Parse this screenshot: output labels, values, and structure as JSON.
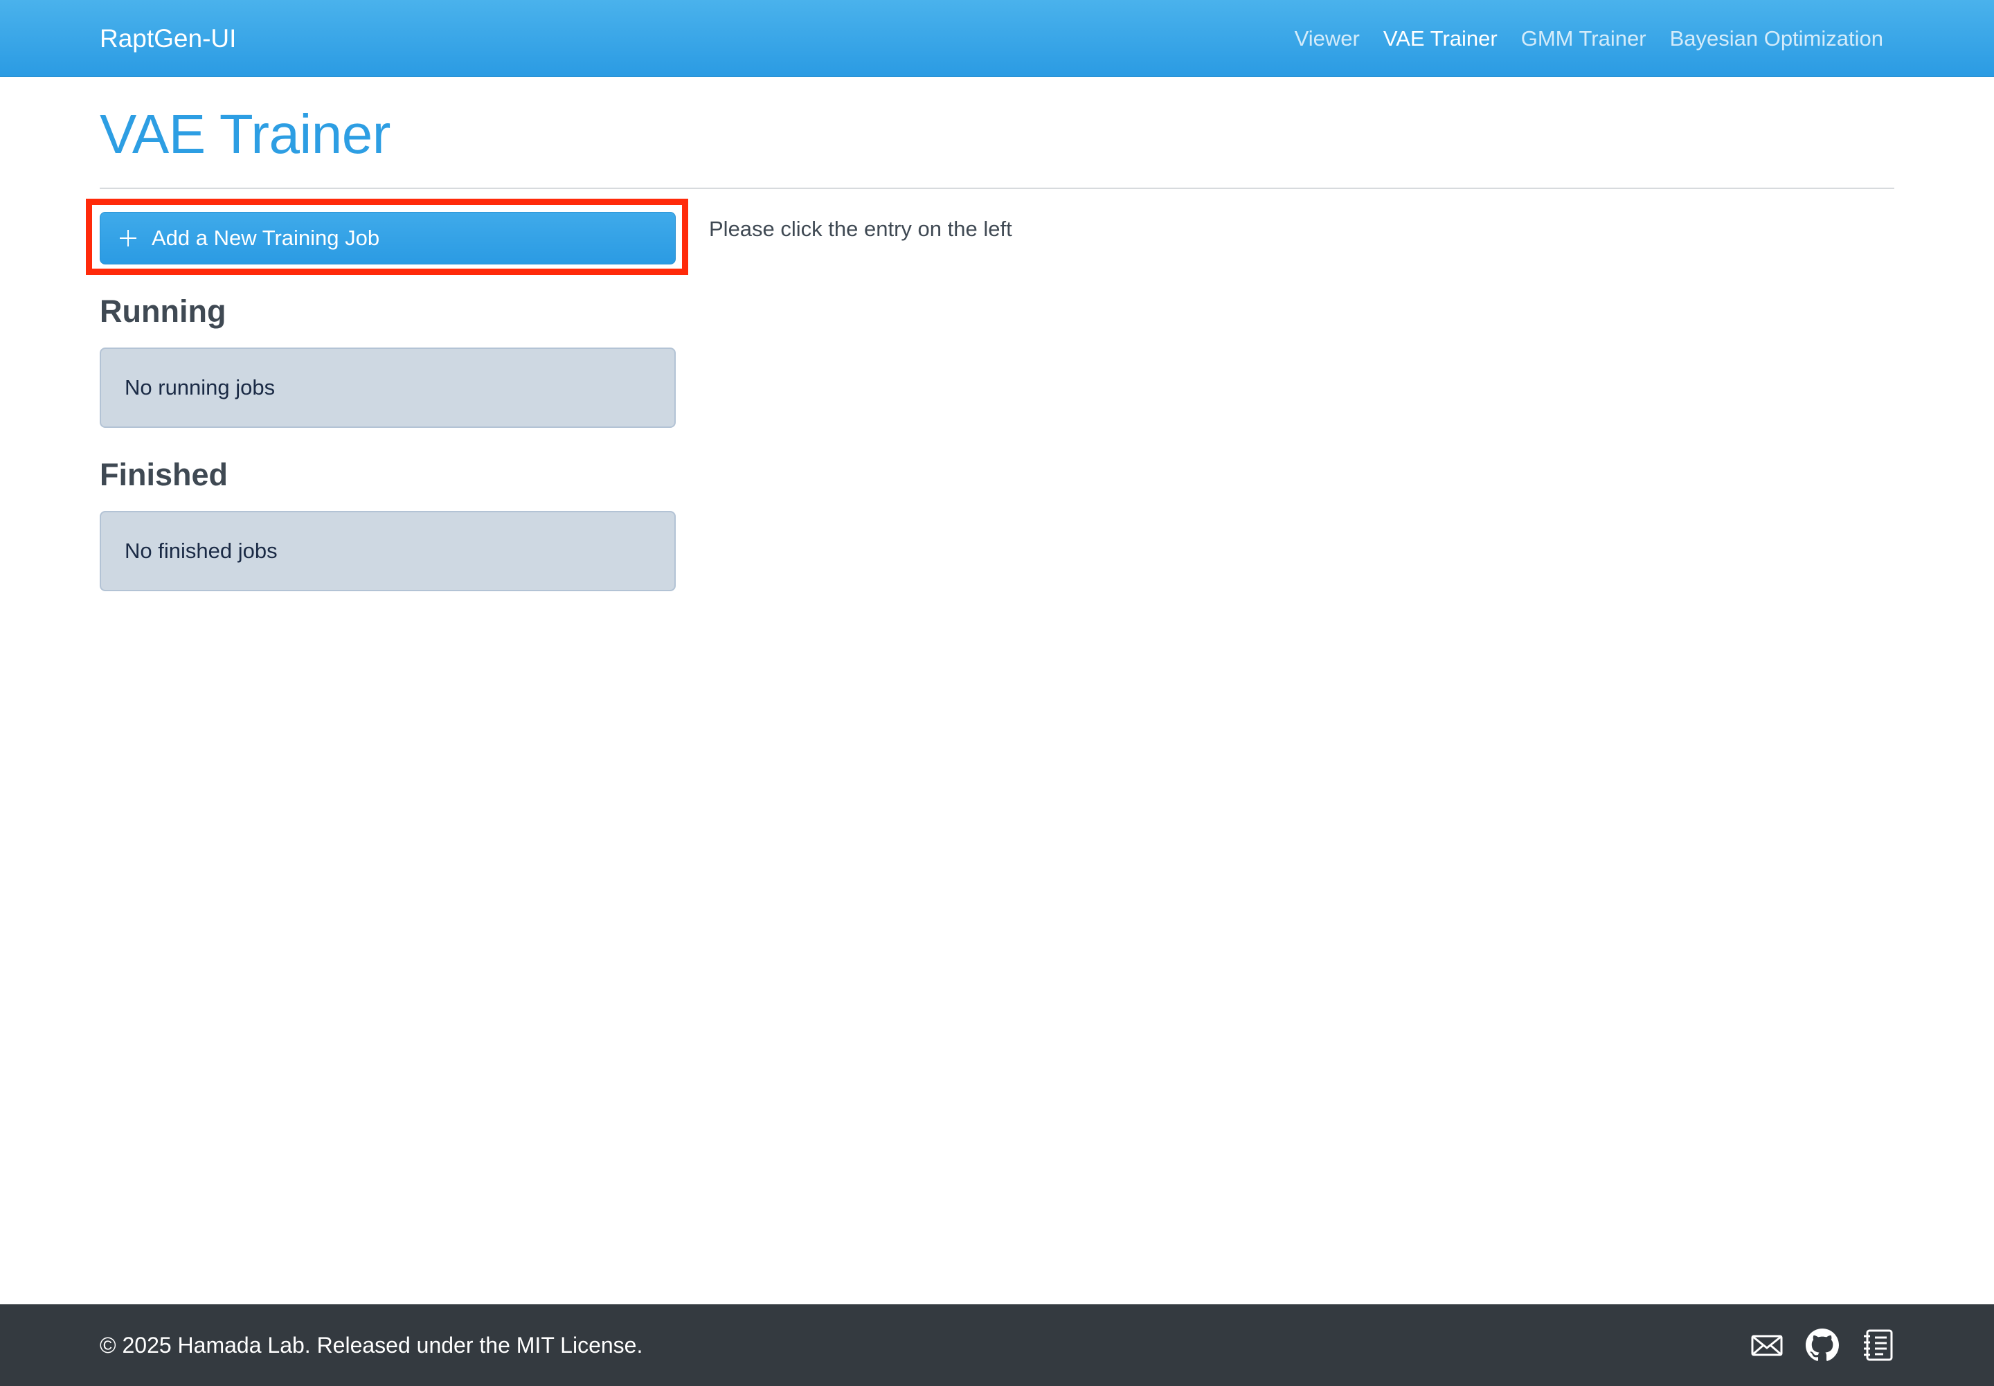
{
  "navbar": {
    "brand": "RaptGen-UI",
    "links": [
      {
        "label": "Viewer",
        "active": false
      },
      {
        "label": "VAE Trainer",
        "active": true
      },
      {
        "label": "GMM Trainer",
        "active": false
      },
      {
        "label": "Bayesian Optimization",
        "active": false
      }
    ]
  },
  "page": {
    "title": "VAE Trainer"
  },
  "sidebar": {
    "add_button": {
      "label": "Add a New Training Job",
      "icon": "plus-icon"
    },
    "running": {
      "heading": "Running",
      "empty_text": "No running jobs"
    },
    "finished": {
      "heading": "Finished",
      "empty_text": "No finished jobs"
    }
  },
  "main": {
    "hint": "Please click the entry on the left"
  },
  "footer": {
    "text": "© 2025 Hamada Lab. Released under the MIT License.",
    "icons": [
      "mail-icon",
      "github-icon",
      "docs-icon"
    ]
  },
  "colors": {
    "primary": "#2b9be3",
    "highlight": "#ff2a0a",
    "footer_bg": "#343a40",
    "empty_box_bg": "#ced8e2"
  }
}
